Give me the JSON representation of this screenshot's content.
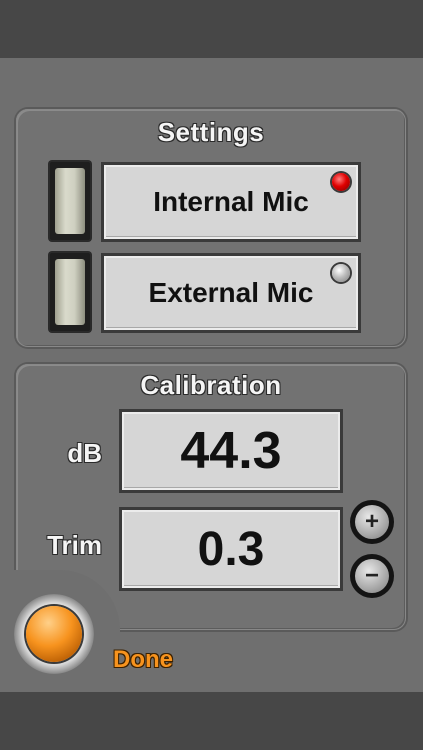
{
  "settings": {
    "title": "Settings",
    "options": [
      {
        "label": "Internal Mic",
        "selected": true
      },
      {
        "label": "External Mic",
        "selected": false
      }
    ],
    "led_on_color": "#e00000",
    "led_off_color": "#bdbdbd"
  },
  "calibration": {
    "title": "Calibration",
    "db_label": "dB",
    "db_value": "44.3",
    "trim_label": "Trim",
    "trim_value": "0.3",
    "plus_symbol": "+",
    "minus_symbol": "−"
  },
  "done": {
    "label": "Done",
    "color": "#f7931e"
  }
}
